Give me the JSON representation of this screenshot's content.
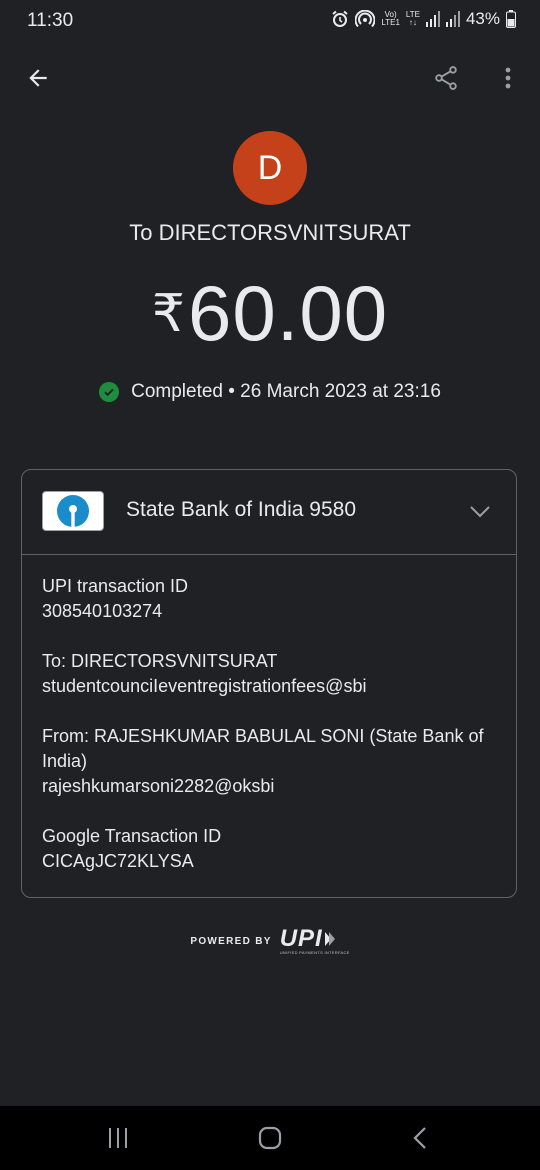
{
  "status_bar": {
    "time": "11:30",
    "volte_label_top": "Vo)",
    "volte_label_bottom": "LTE1",
    "lte_label": "LTE",
    "battery": "43%"
  },
  "transaction": {
    "avatar_letter": "D",
    "recipient_line": "To DIRECTORSVNITSURAT",
    "currency_symbol": "₹",
    "amount": "60.00",
    "status_text": "Completed • 26 March 2023 at 23:16"
  },
  "bank": {
    "name": "State Bank of India 9580"
  },
  "details": {
    "upi_label": "UPI transaction ID",
    "upi_value": "308540103274",
    "to_label": "To: DIRECTORSVNITSURAT",
    "to_value": "studentcounciIeventregistrationfees@sbi",
    "from_label": "From: RAJESHKUMAR BABULAL SONI (State Bank of India)",
    "from_value": "rajeshkumarsoni2282@oksbi",
    "google_label": "Google Transaction ID",
    "google_value": "CICAgJC72KLYSA"
  },
  "footer": {
    "powered_by": "POWERED BY",
    "upi_logo_text": "UPI",
    "upi_logo_sub": "UNIFIED PAYMENTS INTERFACE"
  },
  "colors": {
    "background": "#202124",
    "avatar": "#c5411a",
    "success": "#1e8e3e",
    "sbi_blue": "#1a8ccc"
  }
}
